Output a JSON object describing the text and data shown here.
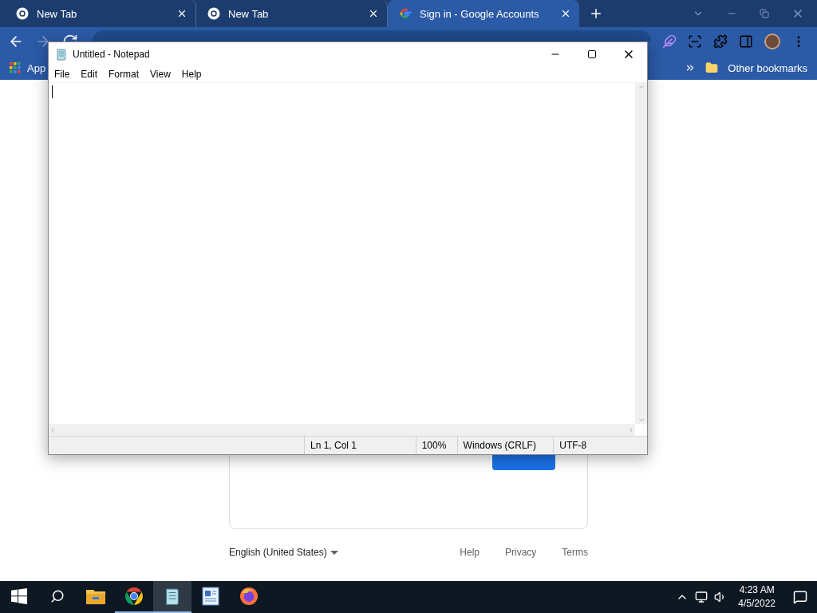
{
  "browser": {
    "tabs": [
      {
        "title": "New Tab",
        "kind": "chrome",
        "selected": false
      },
      {
        "title": "New Tab",
        "kind": "chrome",
        "selected": false
      },
      {
        "title": "Sign in - Google Accounts",
        "kind": "google",
        "selected": true
      }
    ],
    "nav": [
      {
        "kind": "back",
        "disabled": false
      },
      {
        "kind": "forward",
        "disabled": true
      },
      {
        "kind": "reload",
        "disabled": false
      }
    ],
    "bookmarks": {
      "apps_label": "App",
      "other": "Other bookmarks"
    }
  },
  "page": {
    "language": "English (United States)",
    "footer_links": [
      "Help",
      "Privacy",
      "Terms"
    ]
  },
  "notepad": {
    "title": "Untitled - Notepad",
    "menu": [
      "File",
      "Edit",
      "Format",
      "View",
      "Help"
    ],
    "status": [
      "Ln 1, Col 1",
      "100%",
      "Windows (CRLF)",
      "UTF-8"
    ]
  },
  "taskbar": {
    "items": [
      {
        "kind": "start",
        "running": false,
        "selected": false
      },
      {
        "kind": "search",
        "running": false,
        "selected": false
      },
      {
        "kind": "explorer",
        "running": false,
        "selected": false
      },
      {
        "kind": "chrome",
        "running": true,
        "selected": false
      },
      {
        "kind": "notepad",
        "running": true,
        "selected": true
      },
      {
        "kind": "wordpad",
        "running": false,
        "selected": false
      },
      {
        "kind": "firefox",
        "running": false,
        "selected": false
      }
    ],
    "time": "4:23 AM",
    "date": "4/5/2022"
  }
}
